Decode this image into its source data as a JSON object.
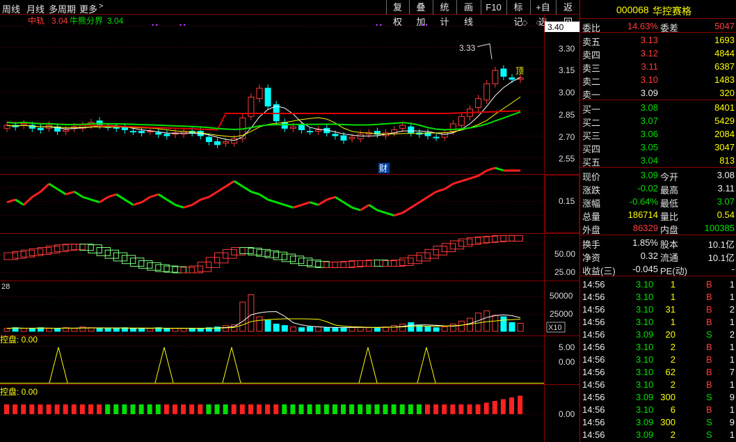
{
  "toolbar": {
    "left_tabs": [
      "周线",
      "月线",
      "多周期",
      "更多"
    ],
    "buttons": [
      "复权",
      "叠加",
      "统计",
      "画线",
      "F10",
      "标记",
      "+自选",
      "返回"
    ]
  },
  "legend": {
    "mid_label": "中轨",
    "mid_value": "3.04",
    "bull_label": "牛熊分界",
    "bull_value": "3.04"
  },
  "price_axis": {
    "current": "3.40",
    "ticks": [
      "3.30",
      "3.15",
      "3.00",
      "2.85",
      "2.70",
      "2.55"
    ]
  },
  "annotations": {
    "high_mark": "3.33",
    "cai_badge": "财",
    "ding_badge": "顶"
  },
  "pane2_axis": [
    "0.15"
  ],
  "pane3_axis": [
    "50.00",
    "25.00"
  ],
  "volume": {
    "left_label": "28",
    "ticks": [
      "50000",
      "25000"
    ],
    "multiplier": "X10"
  },
  "pane5": {
    "label": "控盘: 0.00",
    "ticks": [
      "5.00",
      "0.00"
    ]
  },
  "pane6": {
    "label": "控盘: 0.00",
    "ticks": [
      "0.00"
    ]
  },
  "stock": {
    "code": "000068",
    "name": "华控赛格"
  },
  "quote": {
    "weibi": {
      "label": "委比",
      "value": "14.63%"
    },
    "weicha": {
      "label": "委差",
      "value": "5047"
    },
    "asks": [
      {
        "label": "卖五",
        "price": "3.13",
        "vol": "1693"
      },
      {
        "label": "卖四",
        "price": "3.12",
        "vol": "4844"
      },
      {
        "label": "卖三",
        "price": "3.11",
        "vol": "6387"
      },
      {
        "label": "卖二",
        "price": "3.10",
        "vol": "1483"
      },
      {
        "label": "卖一",
        "price": "3.09",
        "vol": "320"
      }
    ],
    "bids": [
      {
        "label": "买一",
        "price": "3.08",
        "vol": "8401"
      },
      {
        "label": "买二",
        "price": "3.07",
        "vol": "5429"
      },
      {
        "label": "买三",
        "price": "3.06",
        "vol": "2084"
      },
      {
        "label": "买四",
        "price": "3.05",
        "vol": "3047"
      },
      {
        "label": "买五",
        "price": "3.04",
        "vol": "813"
      }
    ],
    "stats": [
      {
        "l1": "现价",
        "v1": "3.09",
        "l2": "今开",
        "v2": "3.08"
      },
      {
        "l1": "涨跌",
        "v1": "-0.02",
        "l2": "最高",
        "v2": "3.11"
      },
      {
        "l1": "涨幅",
        "v1": "-0.64%",
        "l2": "最低",
        "v2": "3.07"
      },
      {
        "l1": "总量",
        "v1": "186714",
        "l2": "量比",
        "v2": "0.54"
      },
      {
        "l1": "外盘",
        "v1": "86329",
        "l2": "内盘",
        "v2": "100385"
      }
    ],
    "stats2": [
      {
        "l1": "换手",
        "v1": "1.85%",
        "l2": "股本",
        "v2": "10.1亿"
      },
      {
        "l1": "净资",
        "v1": "0.32",
        "l2": "流通",
        "v2": "10.1亿"
      },
      {
        "l1": "收益(三)",
        "v1": "-0.045",
        "l2": "PE(动)",
        "v2": "-"
      }
    ]
  },
  "ticks": [
    {
      "time": "14:56",
      "price": "3.10",
      "vol": "1",
      "side": "B",
      "n": "1"
    },
    {
      "time": "14:56",
      "price": "3.10",
      "vol": "1",
      "side": "B",
      "n": "1"
    },
    {
      "time": "14:56",
      "price": "3.10",
      "vol": "31",
      "side": "B",
      "n": "2"
    },
    {
      "time": "14:56",
      "price": "3.10",
      "vol": "1",
      "side": "B",
      "n": "1"
    },
    {
      "time": "14:56",
      "price": "3.09",
      "vol": "20",
      "side": "S",
      "n": "2"
    },
    {
      "time": "14:56",
      "price": "3.10",
      "vol": "2",
      "side": "B",
      "n": "1"
    },
    {
      "time": "14:56",
      "price": "3.10",
      "vol": "2",
      "side": "B",
      "n": "1"
    },
    {
      "time": "14:56",
      "price": "3.10",
      "vol": "62",
      "side": "B",
      "n": "7"
    },
    {
      "time": "14:56",
      "price": "3.10",
      "vol": "2",
      "side": "B",
      "n": "1"
    },
    {
      "time": "14:56",
      "price": "3.09",
      "vol": "300",
      "side": "S",
      "n": "9"
    },
    {
      "time": "14:56",
      "price": "3.10",
      "vol": "6",
      "side": "B",
      "n": "1"
    },
    {
      "time": "14:56",
      "price": "3.09",
      "vol": "300",
      "side": "S",
      "n": "9"
    },
    {
      "time": "14:56",
      "price": "3.09",
      "vol": "2",
      "side": "S",
      "n": "1"
    }
  ],
  "colors": {
    "up": "#ff3b3b",
    "down": "#00ffff",
    "grid": "#8b0000",
    "ma_white": "#ffffff",
    "ma_yellow": "#ffff00",
    "bb_green": "#00e000",
    "bb_red": "#e00000"
  }
}
